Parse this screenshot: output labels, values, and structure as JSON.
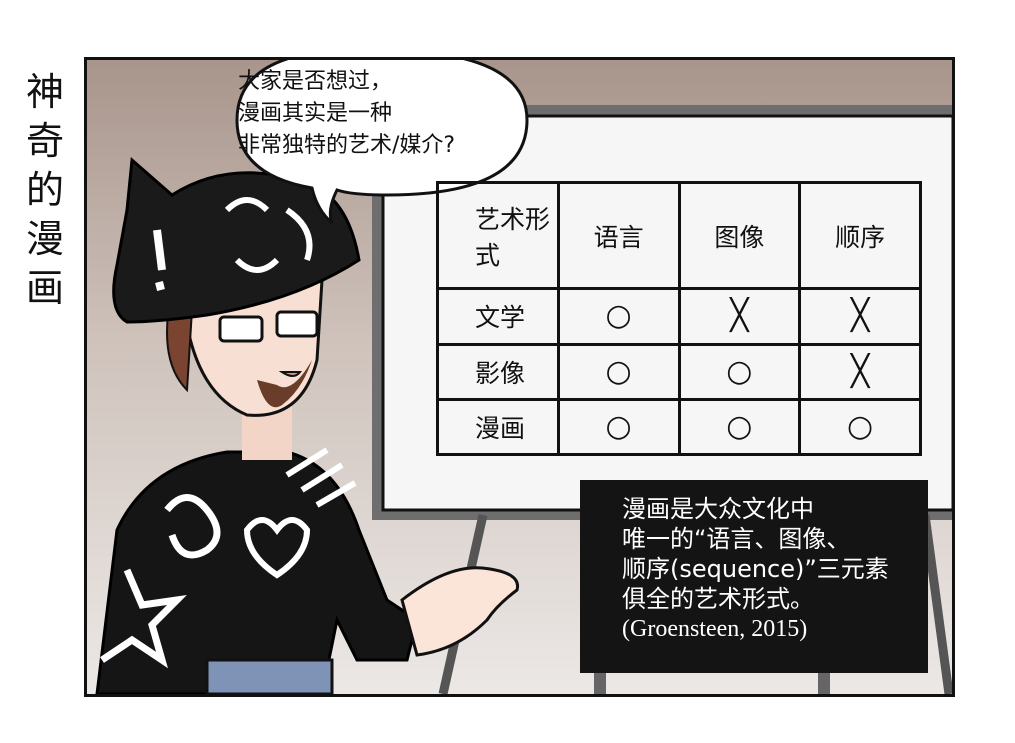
{
  "side_title": "神奇的漫画",
  "speech_bubble": {
    "lines": [
      "大家是否想过，",
      "漫画其实是一种",
      "非常独特的艺术/媒介?"
    ]
  },
  "table": {
    "headers": [
      "艺术形式",
      "语言",
      "图像",
      "顺序"
    ],
    "rows": [
      {
        "label": "文学",
        "marks": [
          "○",
          "╳",
          "╳"
        ]
      },
      {
        "label": "影像",
        "marks": [
          "○",
          "○",
          "╳"
        ]
      },
      {
        "label": "漫画",
        "marks": [
          "○",
          "○",
          "○"
        ]
      }
    ]
  },
  "caption": {
    "lines": [
      "漫画是大众文化中",
      "唯一的“语言、图像、",
      "顺序(sequence)”三元素",
      "俱全的艺术形式。"
    ],
    "citation": "(Groensteen, 2015)"
  }
}
